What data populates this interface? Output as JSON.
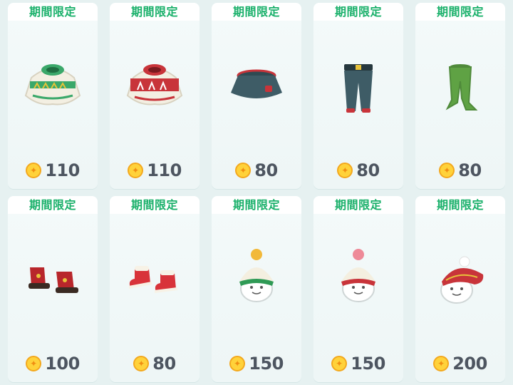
{
  "items": [
    {
      "badge": "期間限定",
      "price": "110",
      "icon": "green-christmas-sweater-icon"
    },
    {
      "badge": "期間限定",
      "price": "110",
      "icon": "red-christmas-sweater-icon"
    },
    {
      "badge": "期間限定",
      "price": "80",
      "icon": "denim-skirt-icon"
    },
    {
      "badge": "期間限定",
      "price": "80",
      "icon": "denim-pants-icon"
    },
    {
      "badge": "期間限定",
      "price": "80",
      "icon": "green-tights-icon"
    },
    {
      "badge": "期間限定",
      "price": "100",
      "icon": "red-lace-boots-icon"
    },
    {
      "badge": "期間限定",
      "price": "80",
      "icon": "red-fur-boots-icon"
    },
    {
      "badge": "期間限定",
      "price": "150",
      "icon": "green-pompom-beanie-icon"
    },
    {
      "badge": "期間限定",
      "price": "150",
      "icon": "red-pompom-beanie-icon"
    },
    {
      "badge": "期間限定",
      "price": "200",
      "icon": "red-knit-beret-icon"
    }
  ],
  "colors": {
    "badge_text": "#19b06a",
    "price_text": "#4d5560",
    "coin": "#ffd23a",
    "background": "#e6f1f1"
  }
}
